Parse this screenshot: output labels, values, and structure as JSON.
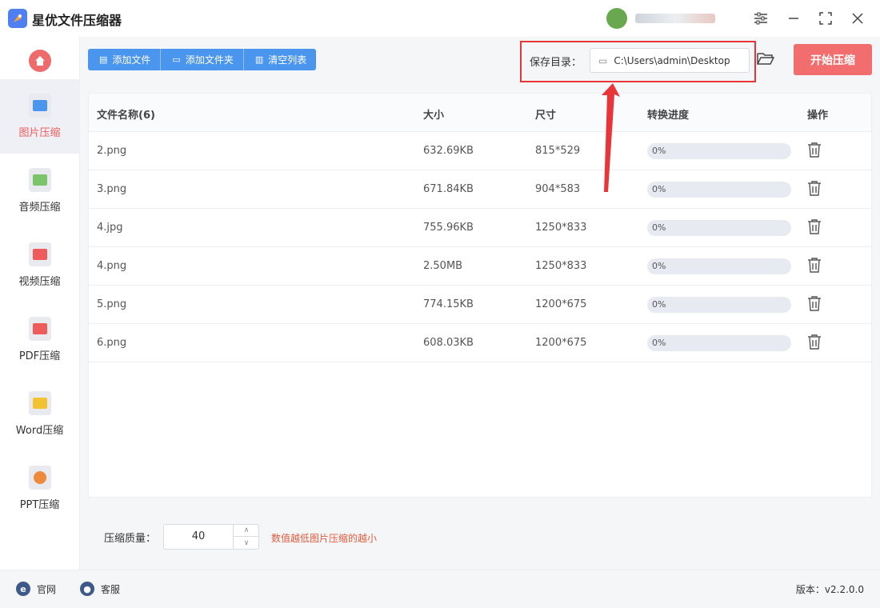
{
  "app": {
    "title": "星优文件压缩器"
  },
  "sidebar": {
    "items": [
      {
        "label": "图片压缩",
        "icon": "image-icon",
        "color": "#4a95ee"
      },
      {
        "label": "音频压缩",
        "icon": "music-icon",
        "color": "#7cc46a"
      },
      {
        "label": "视频压缩",
        "icon": "video-icon",
        "color": "#ee5b5b"
      },
      {
        "label": "PDF压缩",
        "icon": "pdf-icon",
        "color": "#ee5b5b"
      },
      {
        "label": "Word压缩",
        "icon": "word-icon",
        "color": "#f2c233"
      },
      {
        "label": "PPT压缩",
        "icon": "ppt-icon",
        "color": "#ee8a3b"
      }
    ]
  },
  "toolbar": {
    "add_file": "添加文件",
    "add_folder": "添加文件夹",
    "clear_list": "清空列表",
    "save_label": "保存目录：",
    "save_path": "C:\\Users\\admin\\Desktop",
    "start": "开始压缩"
  },
  "table": {
    "headers": {
      "name": "文件名称(6)",
      "size": "大小",
      "dim": "尺寸",
      "progress": "转换进度",
      "ops": "操作"
    },
    "rows": [
      {
        "name": "2.png",
        "size": "632.69KB",
        "dim": "815*529",
        "progress": "0%",
        "progress_value": 0
      },
      {
        "name": "3.png",
        "size": "671.84KB",
        "dim": "904*583",
        "progress": "0%",
        "progress_value": 0
      },
      {
        "name": "4.jpg",
        "size": "755.96KB",
        "dim": "1250*833",
        "progress": "0%",
        "progress_value": 0
      },
      {
        "name": "4.png",
        "size": "2.50MB",
        "dim": "1250*833",
        "progress": "0%",
        "progress_value": 0
      },
      {
        "name": "5.png",
        "size": "774.15KB",
        "dim": "1200*675",
        "progress": "0%",
        "progress_value": 0
      },
      {
        "name": "6.png",
        "size": "608.03KB",
        "dim": "1200*675",
        "progress": "0%",
        "progress_value": 0
      }
    ]
  },
  "quality": {
    "label": "压缩质量：",
    "value": "40",
    "hint": "数值越低图片压缩的越小"
  },
  "footer": {
    "website": "官网",
    "service": "客服",
    "version": "版本：v2.2.0.0"
  },
  "colors": {
    "accent_blue": "#4a95ee",
    "accent_red": "#f26d6d",
    "highlight": "#e8353a"
  }
}
